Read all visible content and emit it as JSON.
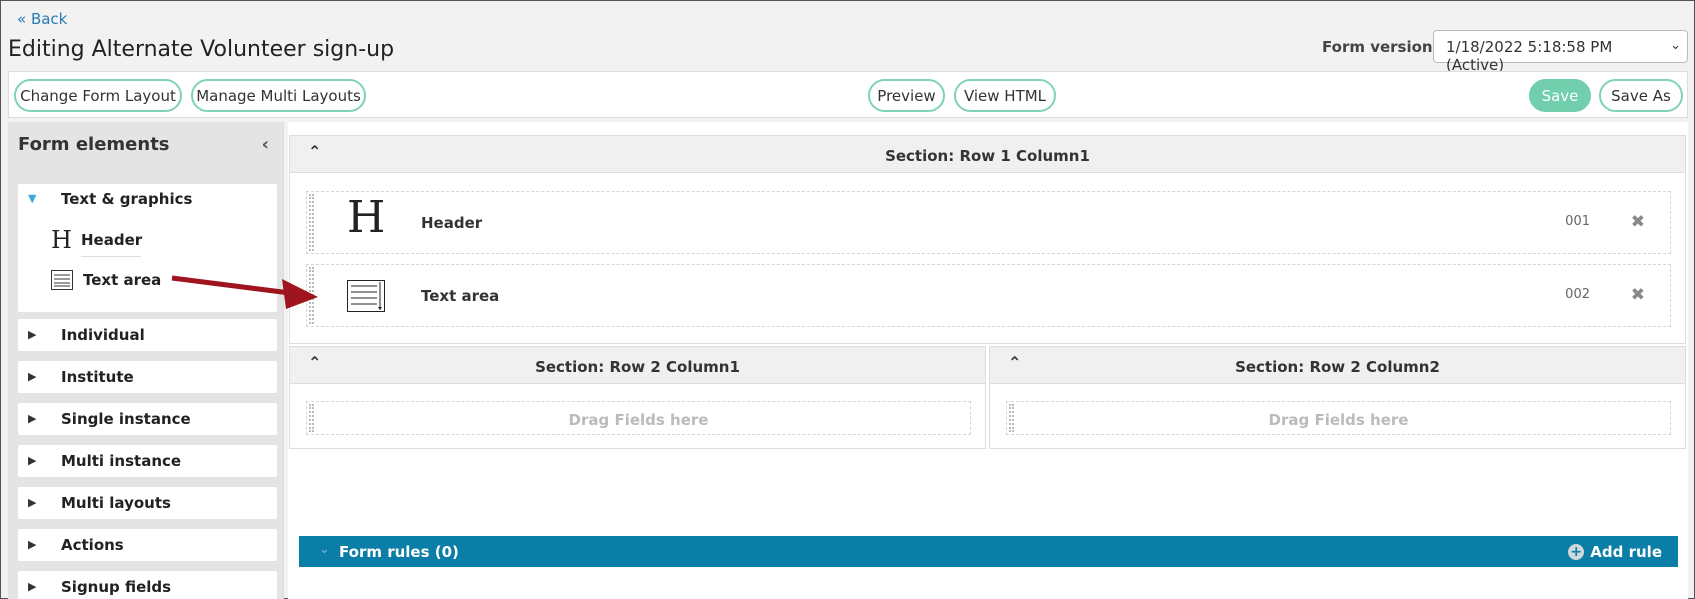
{
  "header": {
    "back": "« Back",
    "title": "Editing Alternate Volunteer sign-up",
    "version_label": "Form version",
    "version_value": "1/18/2022 5:18:58 PM (Active)"
  },
  "toolbar": {
    "change_layout": "Change Form Layout",
    "manage_multi": "Manage Multi Layouts",
    "preview": "Preview",
    "view_html": "View HTML",
    "save": "Save",
    "save_as": "Save As"
  },
  "sidebar": {
    "title": "Form elements",
    "categories": [
      {
        "label": "Text & graphics",
        "expanded": true,
        "items": [
          {
            "label": "Header",
            "icon": "header-icon"
          },
          {
            "label": "Text area",
            "icon": "text-area-icon"
          }
        ]
      },
      {
        "label": "Individual"
      },
      {
        "label": "Institute"
      },
      {
        "label": "Single instance"
      },
      {
        "label": "Multi instance"
      },
      {
        "label": "Multi layouts"
      },
      {
        "label": "Actions"
      },
      {
        "label": "Signup fields"
      }
    ]
  },
  "sections": [
    {
      "title": "Section: Row 1 Column1",
      "fields": [
        {
          "label": "Header",
          "number": "001",
          "icon": "header-icon"
        },
        {
          "label": "Text area",
          "number": "002",
          "icon": "text-area-icon"
        }
      ]
    },
    {
      "title": "Section: Row 2 Column1",
      "drop_text": "Drag Fields here"
    },
    {
      "title": "Section: Row 2 Column2",
      "drop_text": "Drag Fields here"
    }
  ],
  "rules": {
    "title": "Form rules (0)",
    "add": "Add rule"
  },
  "colors": {
    "accent": "#72cfae",
    "rules_bar": "#0b7ea8",
    "arrow": "#a0141f",
    "link": "#2a7bb5"
  }
}
